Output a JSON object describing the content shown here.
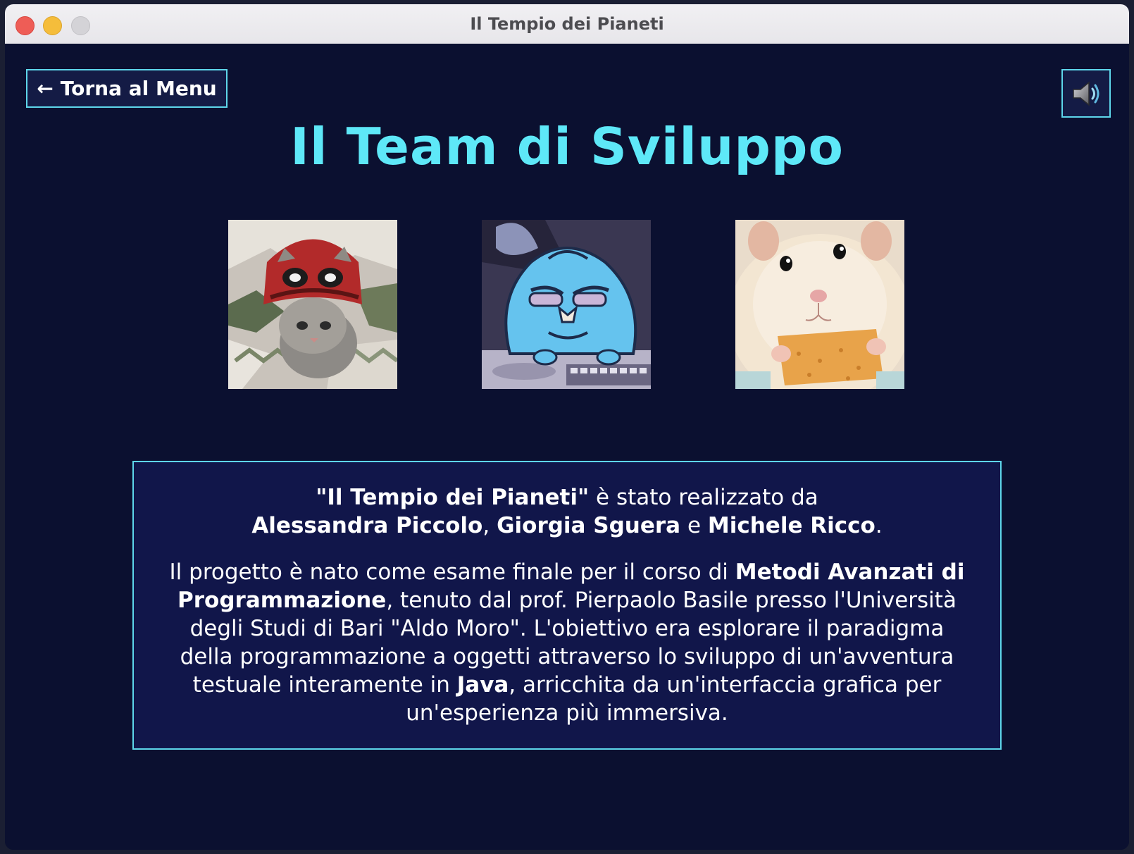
{
  "window": {
    "title": "Il Tempio dei Pianeti"
  },
  "header": {
    "back_arrow": "←",
    "back_label": "Torna al Menu",
    "sound_icon": "speaker-icon"
  },
  "page": {
    "title": "Il Team di Sviluppo"
  },
  "team_photos": [
    {
      "subject": "kitten-in-knitted-hat"
    },
    {
      "subject": "blue-cartoon-character-at-keyboard"
    },
    {
      "subject": "hamster-eating-cracker"
    }
  ],
  "info": {
    "p1": {
      "game_title": "\"Il Tempio dei Pianeti\"",
      "made_by": " è stato realizzato da",
      "author1": "Alessandra Piccolo",
      "comma": ", ",
      "author2": "Giorgia Sguera",
      "and": " e ",
      "author3": "Michele Ricco",
      "period": "."
    },
    "p2": {
      "t1": "Il progetto è nato come esame finale per il corso di ",
      "course": "Metodi Avanzati di Programmazione",
      "t2": ", tenuto dal prof. Pierpaolo Basile presso l'Università degli Studi di Bari \"Aldo Moro\". L'obiettivo era esplorare il paradigma della programmazione a oggetti attraverso lo sviluppo di un'avventura testuale interamente in ",
      "lang": "Java",
      "t3": ", arricchita da un'interfaccia grafica per un'esperienza più immersiva."
    }
  },
  "colors": {
    "background": "#0b1030",
    "accent": "#5ee8f8",
    "border": "#5ed6ea",
    "panel": "#11164a"
  }
}
